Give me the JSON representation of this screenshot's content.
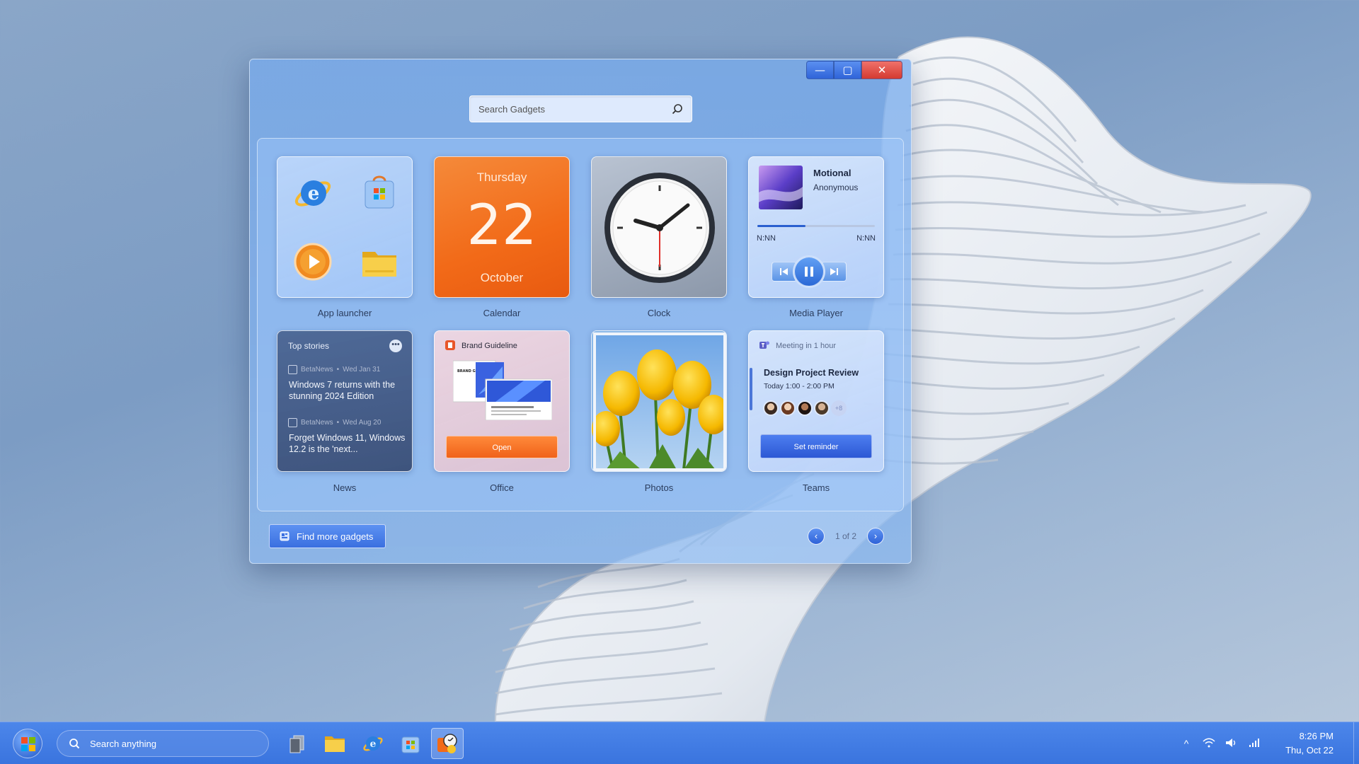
{
  "window": {
    "controls": {
      "minimize": "—",
      "maximize": "▢",
      "close": "✕"
    },
    "search": {
      "placeholder": "Search Gadgets"
    }
  },
  "gadgets": {
    "app_launcher": {
      "label": "App launcher",
      "icons": [
        "ie-icon",
        "store-icon",
        "media-player-icon",
        "folder-icon"
      ]
    },
    "calendar": {
      "label": "Calendar",
      "weekday": "Thursday",
      "day": "22",
      "month": "October"
    },
    "clock": {
      "label": "Clock"
    },
    "media_player": {
      "label": "Media Player",
      "title": "Motional",
      "artist": "Anonymous",
      "time_elapsed": "N:NN",
      "time_total": "N:NN",
      "progress": 0.41
    },
    "news": {
      "label": "News",
      "header": "Top stories",
      "more": "•••",
      "items": [
        {
          "source": "BetaNews",
          "date": "Wed Jan 31",
          "title": "Windows 7 returns with the stunning 2024 Edition"
        },
        {
          "source": "BetaNews",
          "date": "Wed Aug 20",
          "title": "Forget Windows 11, Windows 12.2 is the 'next..."
        }
      ]
    },
    "office": {
      "label": "Office",
      "doc_title": "Brand Guideline",
      "open_button": "Open",
      "thumb_text": "BRAND GUIDELINE"
    },
    "photos": {
      "label": "Photos"
    },
    "teams": {
      "label": "Teams",
      "header": "Meeting in 1 hour",
      "title": "Design Project Review",
      "time": "Today 1:00 - 2:00 PM",
      "more_attendees": "+8",
      "button": "Set reminder"
    }
  },
  "footer": {
    "find_more": "Find more gadgets",
    "pager": {
      "text": "1 of 2",
      "prev": "‹",
      "next": "›"
    }
  },
  "taskbar": {
    "search_placeholder": "Search anything",
    "apps": [
      "task-view-icon",
      "file-explorer-icon",
      "ie-icon",
      "store-icon",
      "gadgets-icon"
    ],
    "tray": {
      "chevron": "^",
      "time": "8:26 PM",
      "date": "Thu, Oct 22"
    }
  },
  "colors": {
    "accent": "#3a74de",
    "calendar_orange": "#f26a18",
    "close_red": "#d43a31"
  }
}
